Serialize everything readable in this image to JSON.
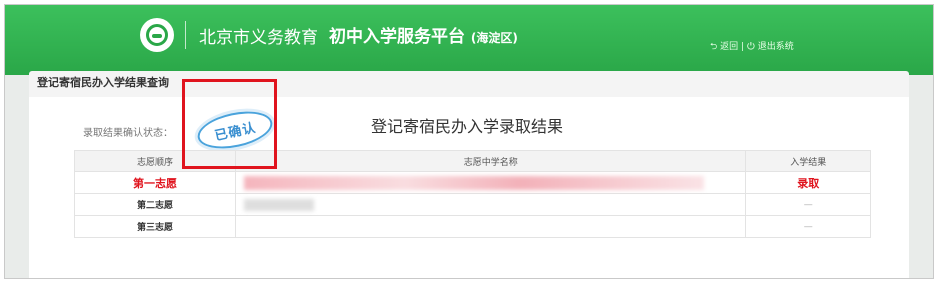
{
  "header": {
    "title_city": "北京市义务教育",
    "title_platform": "初中入学服务平台",
    "district": "(海淀区)",
    "top_links": "⮌ 返回 | ⏻ 退出系统"
  },
  "tab": {
    "label": "登记寄宿民办入学结果查询"
  },
  "status": {
    "label": "录取结果确认状态：",
    "stamp_text": "已确认"
  },
  "result": {
    "title": "登记寄宿民办入学录取结果"
  },
  "table": {
    "headers": [
      "志愿顺序",
      "志愿中学名称",
      "入学结果"
    ],
    "rows": [
      {
        "order": "第一志愿",
        "school": "",
        "result": "录取"
      },
      {
        "order": "第二志愿",
        "school": "",
        "result": "—"
      },
      {
        "order": "第三志愿",
        "school": "",
        "result": "—"
      }
    ]
  },
  "colors": {
    "brand_green": "#2aa748",
    "highlight_red": "#e0141e",
    "stamp_blue": "#3a8fd0"
  }
}
